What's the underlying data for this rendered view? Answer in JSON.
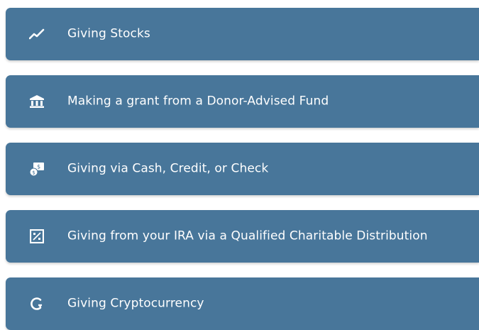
{
  "giving_options": [
    {
      "label": "Giving Stocks",
      "icon": "chart-line-icon"
    },
    {
      "label": "Making a grant from a Donor-Advised Fund",
      "icon": "bank-icon"
    },
    {
      "label": "Giving via Cash, Credit, or Check",
      "icon": "money-icon"
    },
    {
      "label": "Giving from your IRA via a Qualified Charitable Distribution",
      "icon": "percent-square-icon"
    },
    {
      "label": "Giving Cryptocurrency",
      "icon": "crypto-icon"
    }
  ],
  "colors": {
    "row_background": "#48769a",
    "text": "#ffffff",
    "page_background": "#ffffff"
  }
}
